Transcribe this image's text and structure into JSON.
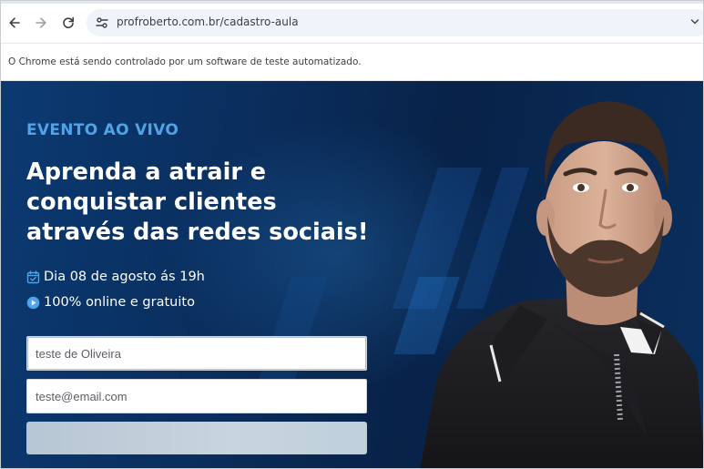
{
  "browser": {
    "url": "profroberto.com.br/cadastro-aula",
    "icons": {
      "back": "arrow-left-icon",
      "forward": "arrow-right-icon",
      "reload": "reload-icon",
      "site_info": "tune-icon"
    }
  },
  "infobar": {
    "message": "O Chrome está sendo controlado por um software de teste automatizado."
  },
  "hero": {
    "eyebrow": "EVENTO AO VIVO",
    "headline": [
      "Aprenda a atrair e",
      "conquistar clientes",
      "através das redes sociais!"
    ],
    "date_text": "Dia 08 de agosto ás 19h",
    "online_text": "100% online e gratuito",
    "colors": {
      "accent": "#4fa3e6",
      "background": "#0a2d5c",
      "text": "#ffffff"
    }
  },
  "form": {
    "name_value": "teste de Oliveira",
    "email_value": "teste@email.com",
    "submit_label": ""
  }
}
